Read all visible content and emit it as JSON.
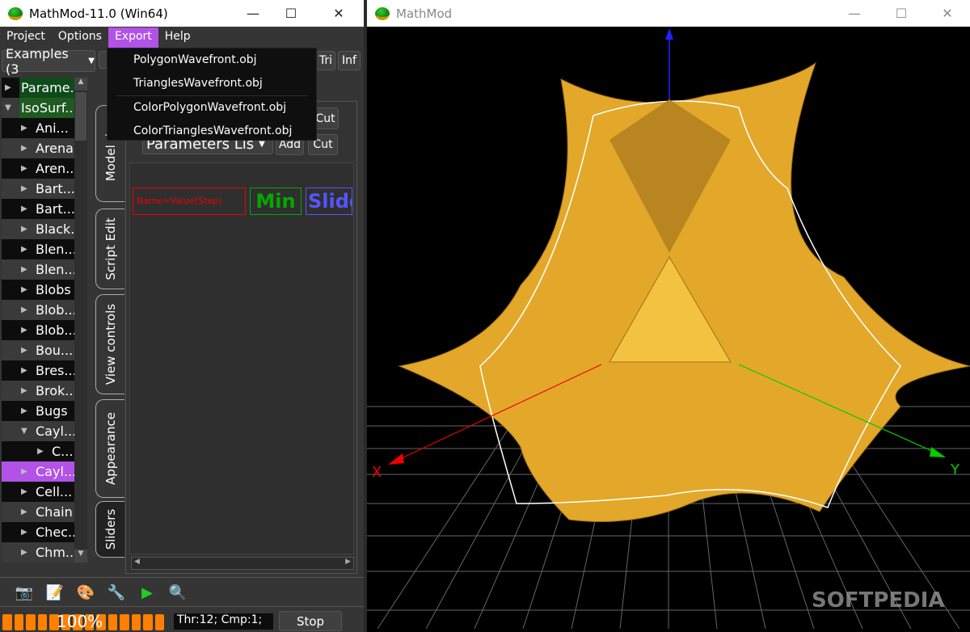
{
  "left_window": {
    "title": "MathMod-11.0 (Win64)",
    "menu": [
      "Project",
      "Options",
      "Export",
      "Help"
    ],
    "active_menu": "Export",
    "export_menu": [
      "PolygonWavefront.obj",
      "TrianglesWavefront.obj",
      "ColorPolygonWavefront.obj",
      "ColorTrianglesWavefront.obj"
    ],
    "examples_combo": "Examples (3",
    "toolbar_buttons": {
      "tri": "Tri",
      "inf": "Inf"
    },
    "tree": [
      {
        "label": "Parame..",
        "level": 0,
        "expanded": false,
        "style": "category"
      },
      {
        "label": "IsoSurf..",
        "level": 0,
        "expanded": true,
        "style": "category"
      },
      {
        "label": "Ani...",
        "level": 1
      },
      {
        "label": "Arena",
        "level": 1
      },
      {
        "label": "Aren..",
        "level": 1
      },
      {
        "label": "Bart...",
        "level": 1
      },
      {
        "label": "Bart...",
        "level": 1
      },
      {
        "label": "Black..",
        "level": 1
      },
      {
        "label": "Blen...",
        "level": 1
      },
      {
        "label": "Blen...",
        "level": 1
      },
      {
        "label": "Blobs",
        "level": 1
      },
      {
        "label": "Blob...",
        "level": 1
      },
      {
        "label": "Blob...",
        "level": 1
      },
      {
        "label": "Bou...",
        "level": 1
      },
      {
        "label": "Bres...",
        "level": 1
      },
      {
        "label": "Brok...",
        "level": 1
      },
      {
        "label": "Bugs",
        "level": 1
      },
      {
        "label": "Cayl...",
        "level": 1,
        "expanded": true
      },
      {
        "label": "C...",
        "level": 2
      },
      {
        "label": "Cayl...",
        "level": 1,
        "selected": true
      },
      {
        "label": "Cell...",
        "level": 1
      },
      {
        "label": "Chain",
        "level": 1
      },
      {
        "label": "Chec...",
        "level": 1
      },
      {
        "label": "Chm...",
        "level": 1
      }
    ],
    "tabs": [
      "Model de",
      "Script Edit",
      "View controls",
      "Appearance",
      "Sliders"
    ],
    "sliders_panel": {
      "combo": "Parameters Lis",
      "add": "Add",
      "cut": "Cut",
      "cut_top": "Cut",
      "name_field": "Name=Value(Step)",
      "min_label": "Min",
      "slider_label": "Slide"
    },
    "bottom_icons": [
      "camera-icon",
      "notepad-icon",
      "palette-icon",
      "wrench-icon",
      "play-icon",
      "magnifier-icon"
    ],
    "progress": {
      "value": 100,
      "label": "100%"
    },
    "thread_info": "Thr:12; Cmp:1;",
    "stop": "Stop"
  },
  "right_window": {
    "title": "MathMod",
    "axes": {
      "x": "X",
      "y": "Y"
    },
    "surface_color": "#e3a82a",
    "watermark": "SOFTPEDIA"
  },
  "colors": {
    "menu_active": "#b252e6",
    "progress": "#ff7f00",
    "category_bg": "#0f4a1a",
    "selected_bg": "#b252e6"
  }
}
